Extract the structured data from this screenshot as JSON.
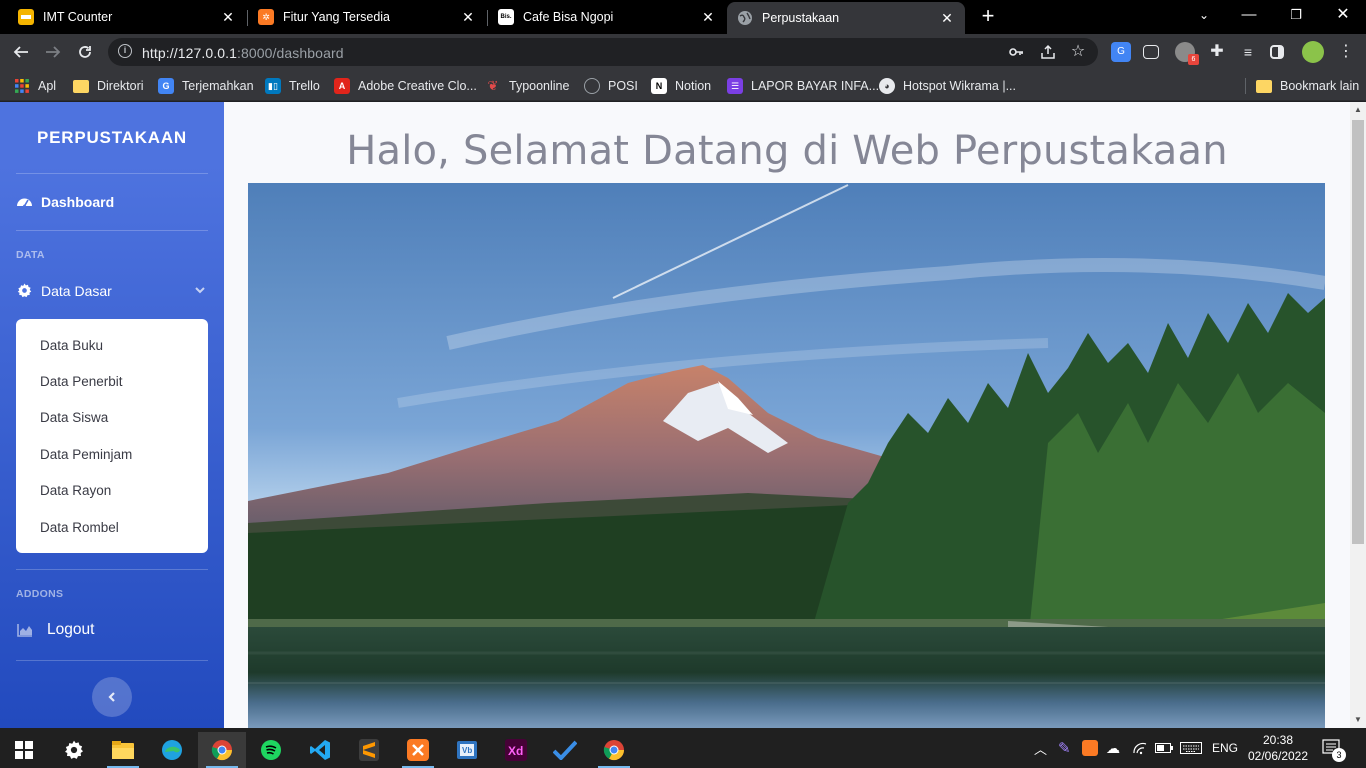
{
  "tabs": [
    {
      "title": "IMT Counter",
      "icon": "yellow-square-icon",
      "color": "#f4b400"
    },
    {
      "title": "Fitur Yang Tersedia",
      "icon": "xampp-icon",
      "color": "#fb7a24"
    },
    {
      "title": "Cafe Bisa Ngopi",
      "icon": "bisa-icon",
      "color": "#ffffff"
    },
    {
      "title": "Perpustakaan",
      "icon": "globe-icon",
      "color": "#9aa0a6"
    }
  ],
  "url": {
    "host": "http://127.0.0.1",
    "rest": ":8000/dashboard"
  },
  "bookmarks": [
    {
      "label": "Apl",
      "icon": "apps-grid-icon",
      "color": "#ea4335"
    },
    {
      "label": "Direktori",
      "icon": "folder-icon",
      "color": "#fdd663"
    },
    {
      "label": "Terjemahkan",
      "icon": "translate-icon",
      "color": "#4285f4"
    },
    {
      "label": "Trello",
      "icon": "trello-icon",
      "color": "#0079bf"
    },
    {
      "label": "Adobe Creative Clo...",
      "icon": "adobe-icon",
      "color": "#e1251b"
    },
    {
      "label": "Typoonline",
      "icon": "typo-icon",
      "color": "#e24a4a"
    },
    {
      "label": "POSI",
      "icon": "posi-icon",
      "color": "#9aa0a6"
    },
    {
      "label": "Notion",
      "icon": "notion-icon",
      "color": "#ffffff"
    },
    {
      "label": "LAPOR BAYAR INFA...",
      "icon": "list-icon",
      "color": "#7b3fe4"
    },
    {
      "label": "Hotspot Wikrama |...",
      "icon": "globe-icon",
      "color": "#e8eaed"
    }
  ],
  "bookmark_other": "Bookmark lain",
  "sidebar": {
    "brand": "PERPUSTAKAAN",
    "dashboard": "Dashboard",
    "heading_data": "DATA",
    "data_dasar": "Data Dasar",
    "submenu": [
      "Data Buku",
      "Data Penerbit",
      "Data Siswa",
      "Data Peminjam",
      "Data Rayon",
      "Data Rombel"
    ],
    "heading_addons": "ADDONS",
    "logout": "Logout"
  },
  "main": {
    "heading": "Halo, Selamat Datang di Web Perpustakaan"
  },
  "taskbar": {
    "lang": "ENG",
    "time": "20:38",
    "date": "02/06/2022",
    "notifications": "3"
  },
  "colors": {
    "sidebar_top": "#4e73df",
    "sidebar_bottom": "#224abe",
    "heading": "#858796"
  }
}
